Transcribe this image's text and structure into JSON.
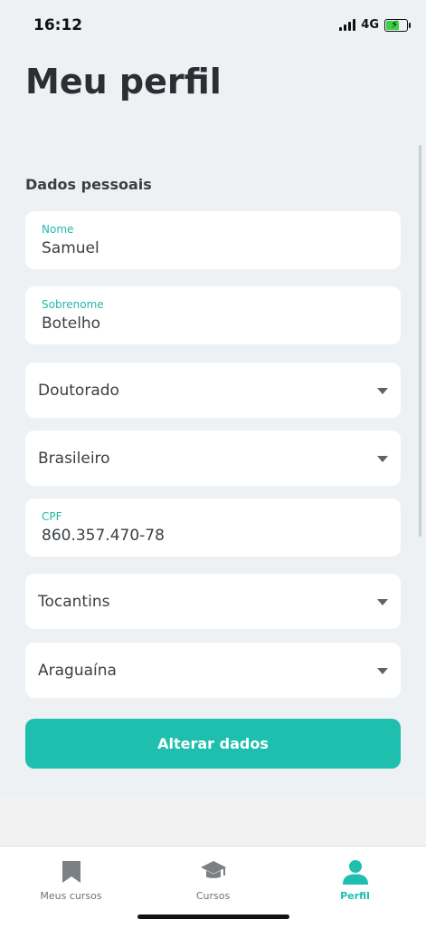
{
  "status_bar": {
    "time": "16:12",
    "network": "4G"
  },
  "header": {
    "title": "Meu perfil"
  },
  "section": {
    "title": "Dados pessoais"
  },
  "fields": {
    "nome": {
      "label": "Nome",
      "value": "Samuel"
    },
    "sobrenome": {
      "label": "Sobrenome",
      "value": "Botelho"
    },
    "escolaridade": {
      "value": "Doutorado"
    },
    "nacionalidade": {
      "value": "Brasileiro"
    },
    "cpf": {
      "label": "CPF",
      "value": "860.357.470-78"
    },
    "estado": {
      "value": "Tocantins"
    },
    "cidade": {
      "value": "Araguaína"
    }
  },
  "actions": {
    "submit_label": "Alterar dados"
  },
  "tab_bar": {
    "tabs": [
      {
        "label": "Meus cursos",
        "icon": "bookmark-icon"
      },
      {
        "label": "Cursos",
        "icon": "graduation-cap-icon"
      },
      {
        "label": "Perfil",
        "icon": "user-icon",
        "active": true
      }
    ]
  },
  "colors": {
    "accent": "#1ebfae",
    "background": "#edf1f3",
    "inactive_icon": "#7b8085"
  }
}
